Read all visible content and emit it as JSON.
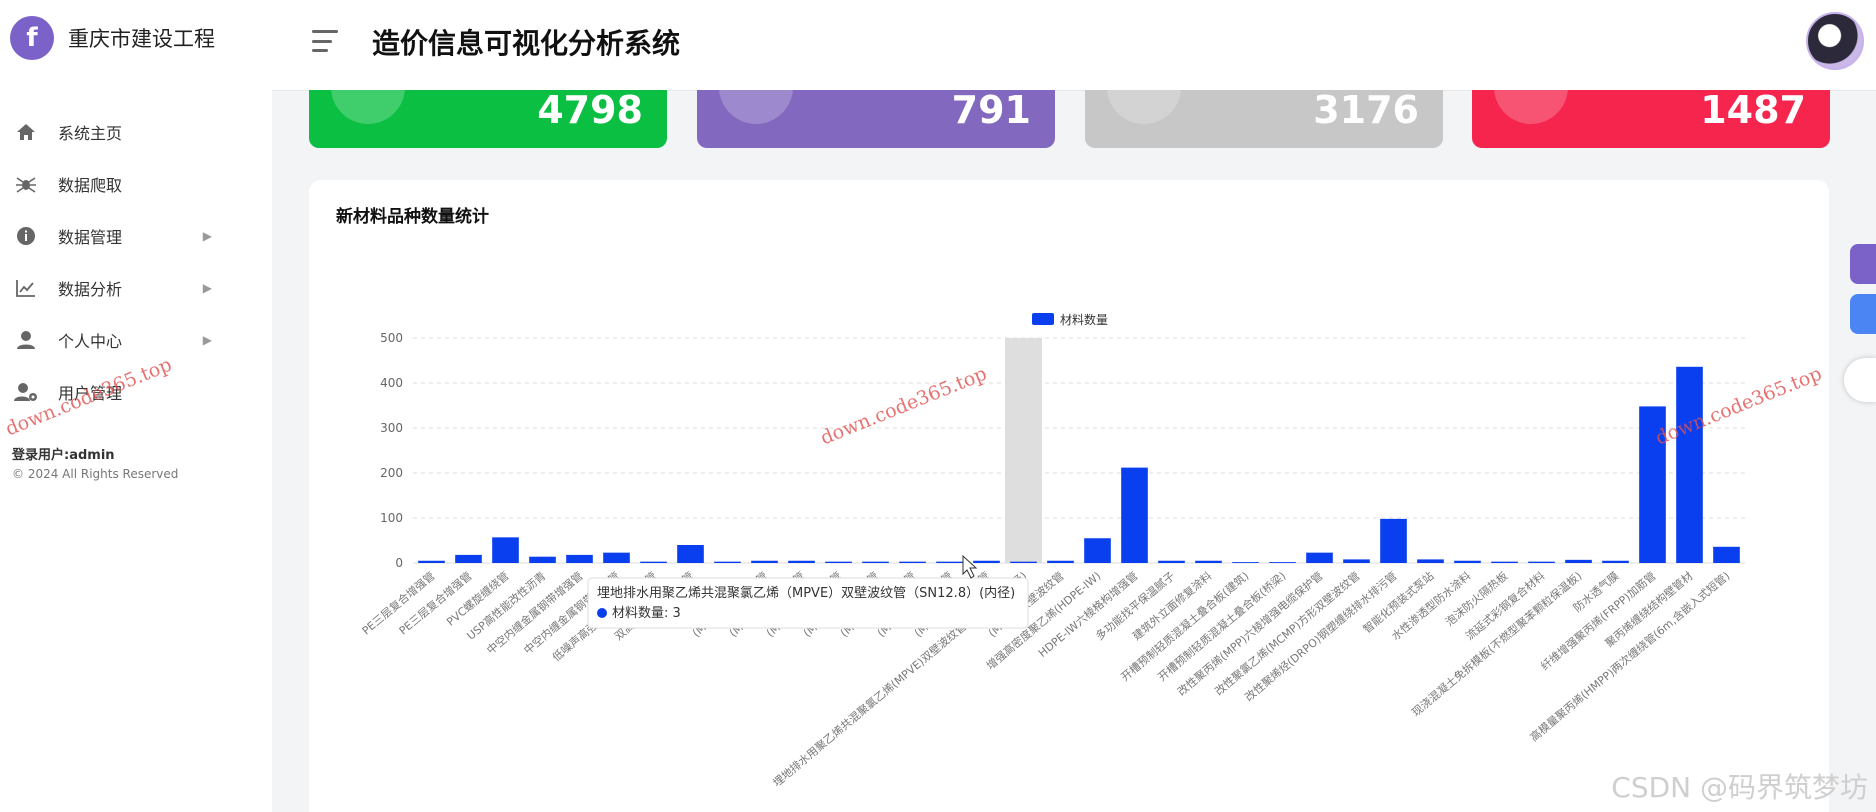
{
  "brand": {
    "name": "重庆市建设工程",
    "logo_letter": "f"
  },
  "header": {
    "title": "造价信息可视化分析系统"
  },
  "sidebar": {
    "items": [
      {
        "label": "系统主页",
        "icon": "home-icon",
        "has_arrow": false
      },
      {
        "label": "数据爬取",
        "icon": "spider-icon",
        "has_arrow": false
      },
      {
        "label": "数据管理",
        "icon": "info-icon",
        "has_arrow": true
      },
      {
        "label": "数据分析",
        "icon": "chart-line-icon",
        "has_arrow": true
      },
      {
        "label": "个人中心",
        "icon": "user-icon",
        "has_arrow": true
      },
      {
        "label": "用户管理",
        "icon": "user-gear-icon",
        "has_arrow": false
      }
    ],
    "login_user": "登录用户:admin",
    "copyright": "© 2024 All Rights Reserved"
  },
  "stats": [
    {
      "value": "4798",
      "color": "#0bbf43"
    },
    {
      "value": "791",
      "color": "#8268bf"
    },
    {
      "value": "3176",
      "color": "#c7c7c7"
    },
    {
      "value": "1487",
      "color": "#f5254e"
    }
  ],
  "panel": {
    "title": "新材料品种数量统计"
  },
  "watermarks": [
    "down.code365.top",
    "down.code365.top",
    "down.code365.top"
  ],
  "csdn_mark": "CSDN @码界筑梦坊",
  "chart_data": {
    "type": "bar",
    "legend": "材料数量",
    "series": [
      {
        "name": "材料数量",
        "color": "#0a3ff0"
      }
    ],
    "ylim": [
      0,
      500
    ],
    "yticks": [
      0,
      100,
      200,
      300,
      400,
      500
    ],
    "grid": true,
    "legend_position": "top-center",
    "categories": [
      "PE三层复合增强管",
      "PE三层复合增强管",
      "PVC螺旋缠绕管",
      "USP高性能改性沥青",
      "中空内缠金属钢带增强管",
      "中空内缠金属钢带波纹管",
      "低噪声高强度聚乙烯波纹管",
      "双高筋增强聚乙烯管",
      "",
      "(MPVE)双壁波纹管",
      "(MPVE)双壁波纹管",
      "(MPVE)双壁波纹管",
      "(MPVE)双壁波纹管",
      "(MPVE)双壁波纹管",
      "(MPVE)双壁波纹管",
      "(MPVE)双壁波纹管",
      "埋地排水用聚乙烯共混聚氯乙烯(MPVE)双壁波纹管(SN12.8)(内径)",
      "(MPVE)双壁波纹管",
      "增强高密度聚乙烯(HDPE-IW)",
      "HDPE-IW六棱格构增强管",
      "多功能找平保温腻子",
      "建筑外立面修复涂料",
      "开槽预制轻质混凝土叠合板(建筑)",
      "开槽预制轻质混凝土叠合板(桥梁)",
      "改性聚丙烯(MPP)六棱增强电缆保护管",
      "改性聚氯乙烯(MCMP)方形双壁波纹管",
      "改性聚烯烃(DRPO)钢塑缠绕排水排污管",
      "智能化预装式泵站",
      "水性渗透型防水涂料",
      "泡沫防火隔热板",
      "流延式彩钢复合材料",
      "现浇混凝土免拆模板(不燃型聚苯颗粒保温板)",
      "防水透气膜",
      "纤维增强聚丙烯(FRPP)加筋管",
      "聚丙烯缠绕结构壁管材",
      "高模量聚丙烯(HMPP)两次缠绕管(6m,含嵌入式短管)"
    ],
    "values": [
      5,
      18,
      57,
      14,
      18,
      23,
      3,
      40,
      3,
      5,
      5,
      3,
      3,
      3,
      3,
      5,
      3,
      5,
      55,
      212,
      5,
      5,
      2,
      2,
      23,
      8,
      98,
      8,
      5,
      3,
      3,
      7,
      5,
      348,
      436,
      36
    ],
    "highlight_index": 16,
    "tooltip": {
      "title": "埋地排水用聚乙烯共混聚氯乙烯（MPVE）双壁波纹管（SN12.8）(内径)",
      "series_label": "材料数量: 3"
    }
  }
}
